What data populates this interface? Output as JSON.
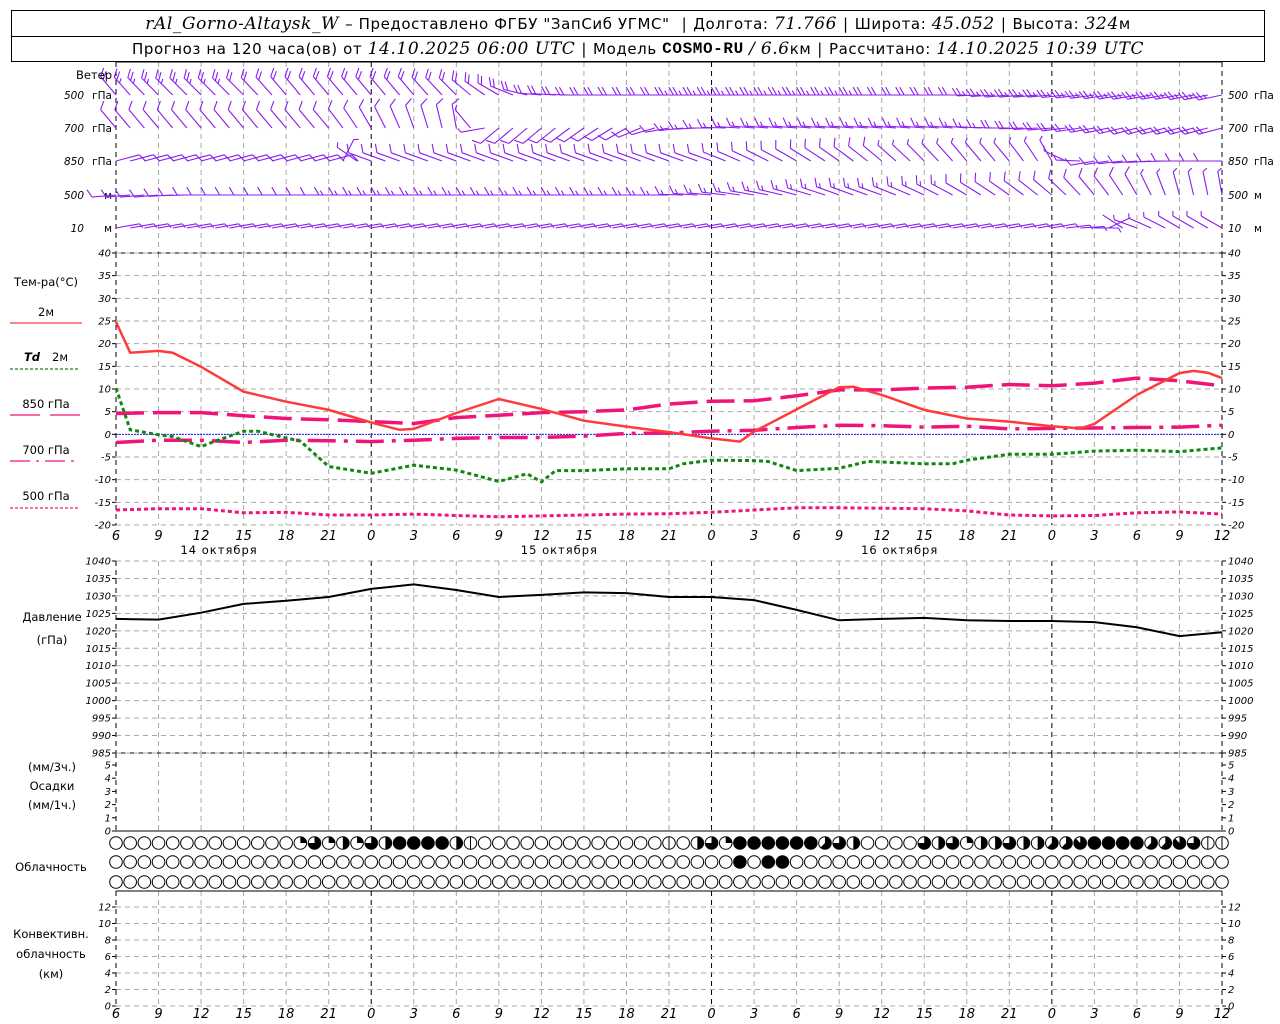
{
  "header": {
    "title": "rAl_Gorno-Altaysk_W",
    "provider": "– Предоставлено ФГБУ \"ЗапСиб УГМС\"",
    "separator": "|",
    "lon_label": "Долгота:",
    "lon": "71.766",
    "lat_label": "Широта:",
    "lat": "45.052",
    "alt_label": "Высота:",
    "alt": "324",
    "alt_unit": "м",
    "forecast_label": "Прогноз на 120 часа(ов) от",
    "forecast_start": "14.10.2025 06:00 UTC",
    "model_label": "Модель",
    "model": "COSMO-RU",
    "slash": "/",
    "resolution": "6.6",
    "resolution_unit": "км",
    "calc_label": "Рассчитано:",
    "calc_time": "14.10.2025 10:39 UTC"
  },
  "colors": {
    "wind": "#8a1cf0",
    "t2m": "#ff3a3a",
    "td2m": "#108810",
    "upper_air": "#f0147a",
    "zero_line": "#2020ff",
    "pressure": "#000000",
    "grid": "#a8a8a8"
  },
  "time_axis": {
    "x": [
      "14.10 06:00",
      "14.10 09:00",
      "14.10 12:00",
      "14.10 15:00",
      "14.10 18:00",
      "14.10 21:00",
      "15.10 00:00",
      "15.10 03:00",
      "15.10 06:00",
      "15.10 09:00",
      "15.10 12:00",
      "15.10 15:00",
      "15.10 18:00",
      "15.10 21:00",
      "16.10 00:00",
      "16.10 03:00",
      "16.10 06:00",
      "16.10 09:00",
      "16.10 12:00",
      "16.10 15:00",
      "16.10 18:00",
      "16.10 21:00",
      "17.10 00:00",
      "17.10 03:00",
      "17.10 06:00",
      "17.10 09:00",
      "17.10 12:00"
    ],
    "tick_labels": [
      "6",
      "9",
      "12",
      "15",
      "18",
      "21",
      "0",
      "3",
      "6",
      "9",
      "12",
      "15",
      "18",
      "21",
      "0",
      "3",
      "6",
      "9",
      "12",
      "15",
      "18",
      "21",
      "0",
      "3",
      "6",
      "9",
      "12"
    ],
    "date_labels": [
      "14 октября",
      "15 октября",
      "16 октября"
    ]
  },
  "chart_data": [
    {
      "type": "wind-barbs",
      "title": "Ветер",
      "levels": [
        {
          "value": "500",
          "unit": "гПа",
          "dir": [
            320,
            315,
            315,
            315,
            320,
            320,
            320,
            320,
            315,
            300,
            275,
            270,
            270,
            270,
            270,
            270,
            270,
            270,
            270,
            270,
            270,
            265,
            265,
            262,
            260,
            260,
            258
          ],
          "speed": [
            22,
            25,
            25,
            22,
            20,
            20,
            20,
            20,
            20,
            20,
            20,
            22,
            22,
            22,
            25,
            25,
            25,
            25,
            22,
            22,
            22,
            25,
            25,
            25,
            25,
            25,
            25
          ]
        },
        {
          "value": "700",
          "unit": "гПа",
          "dir": [
            320,
            320,
            320,
            320,
            320,
            320,
            330,
            340,
            350,
            230,
            230,
            235,
            240,
            260,
            270,
            275,
            275,
            275,
            275,
            275,
            275,
            270,
            265,
            260,
            255,
            255,
            255
          ],
          "speed": [
            12,
            12,
            12,
            12,
            12,
            12,
            10,
            10,
            8,
            8,
            8,
            8,
            10,
            12,
            15,
            15,
            15,
            15,
            15,
            15,
            15,
            18,
            18,
            20,
            20,
            20,
            20
          ]
        },
        {
          "value": "850",
          "unit": "гПа",
          "dir": [
            75,
            75,
            75,
            75,
            75,
            75,
            290,
            290,
            290,
            290,
            290,
            290,
            290,
            290,
            290,
            295,
            300,
            305,
            310,
            315,
            320,
            320,
            330,
            260,
            265,
            270,
            270
          ],
          "speed": [
            8,
            8,
            8,
            8,
            8,
            8,
            12,
            12,
            12,
            12,
            12,
            12,
            12,
            12,
            12,
            12,
            10,
            10,
            8,
            6,
            6,
            6,
            5,
            10,
            12,
            12,
            12
          ]
        },
        {
          "value": "500",
          "unit": "м",
          "dir": [
            265,
            265,
            270,
            270,
            270,
            270,
            270,
            270,
            270,
            270,
            270,
            270,
            270,
            270,
            275,
            280,
            285,
            290,
            290,
            295,
            300,
            305,
            310,
            320,
            330,
            345,
            350
          ],
          "speed": [
            8,
            8,
            10,
            12,
            12,
            12,
            14,
            15,
            15,
            15,
            15,
            15,
            15,
            15,
            15,
            15,
            14,
            14,
            14,
            14,
            12,
            12,
            10,
            10,
            8,
            6,
            6
          ]
        },
        {
          "value": "10",
          "unit": "м",
          "dir": [
            80,
            80,
            80,
            80,
            80,
            80,
            80,
            80,
            80,
            80,
            80,
            80,
            80,
            80,
            80,
            80,
            80,
            80,
            80,
            80,
            80,
            80,
            80,
            90,
            290,
            300,
            300
          ],
          "speed": [
            4,
            5,
            5,
            5,
            5,
            5,
            5,
            5,
            6,
            6,
            6,
            5,
            5,
            5,
            5,
            5,
            5,
            5,
            5,
            5,
            5,
            5,
            5,
            5,
            6,
            7,
            7
          ]
        }
      ]
    },
    {
      "type": "line",
      "legend_title": "Тем-ра(°C)",
      "ylim": [
        -20,
        40
      ],
      "yticks": [
        40,
        35,
        30,
        25,
        20,
        15,
        10,
        5,
        0,
        -5,
        -10,
        -15,
        -20
      ],
      "grid": true,
      "legend_placement": "left",
      "series": [
        {
          "name": "2м",
          "style": "solid",
          "color": "#ff3a3a",
          "points": [
            [
              "14.10 06:00",
              24.8
            ],
            [
              "14.10 07:00",
              18.0
            ],
            [
              "14.10 09:00",
              18.4
            ],
            [
              "14.10 10:00",
              18.0
            ],
            [
              "14.10 12:00",
              14.9
            ],
            [
              "14.10 15:00",
              9.4
            ],
            [
              "14.10 18:00",
              7.2
            ],
            [
              "14.10 21:00",
              5.4
            ],
            [
              "15.10 00:00",
              2.6
            ],
            [
              "15.10 02:00",
              1.0
            ],
            [
              "15.10 03:00",
              1.2
            ],
            [
              "15.10 06:00",
              4.7
            ],
            [
              "15.10 09:00",
              7.8
            ],
            [
              "15.10 12:00",
              5.6
            ],
            [
              "15.10 15:00",
              3.0
            ],
            [
              "15.10 18:00",
              1.7
            ],
            [
              "15.10 21:00",
              0.5
            ],
            [
              "16.10 00:00",
              -0.9
            ],
            [
              "16.10 02:00",
              -1.6
            ],
            [
              "16.10 03:00",
              0.6
            ],
            [
              "16.10 06:00",
              5.5
            ],
            [
              "16.10 09:00",
              10.4
            ],
            [
              "16.10 10:00",
              10.5
            ],
            [
              "16.10 12:00",
              8.7
            ],
            [
              "16.10 15:00",
              5.4
            ],
            [
              "16.10 18:00",
              3.5
            ],
            [
              "16.10 21:00",
              2.8
            ],
            [
              "17.10 00:00",
              1.8
            ],
            [
              "17.10 02:00",
              1.3
            ],
            [
              "17.10 03:00",
              2.3
            ],
            [
              "17.10 06:00",
              8.7
            ],
            [
              "17.10 09:00",
              13.5
            ],
            [
              "17.10 10:00",
              14.0
            ],
            [
              "17.10 11:00",
              13.6
            ],
            [
              "17.10 12:00",
              12.4
            ]
          ]
        },
        {
          "name_prefix": "Td",
          "name": "2м",
          "style": "dotted",
          "color": "#108810",
          "points": [
            [
              "14.10 06:00",
              10.2
            ],
            [
              "14.10 07:00",
              1.0
            ],
            [
              "14.10 09:00",
              -0.1
            ],
            [
              "14.10 10:00",
              -0.5
            ],
            [
              "14.10 12:00",
              -2.7
            ],
            [
              "14.10 13:00",
              -1.5
            ],
            [
              "14.10 15:00",
              0.7
            ],
            [
              "14.10 16:00",
              0.7
            ],
            [
              "14.10 18:00",
              -0.8
            ],
            [
              "14.10 19:00",
              -1.5
            ],
            [
              "14.10 21:00",
              -7.1
            ],
            [
              "15.10 00:00",
              -8.6
            ],
            [
              "15.10 03:00",
              -6.8
            ],
            [
              "15.10 06:00",
              -7.9
            ],
            [
              "15.10 09:00",
              -10.4
            ],
            [
              "15.10 11:00",
              -8.7
            ],
            [
              "15.10 12:00",
              -10.5
            ],
            [
              "15.10 13:00",
              -8.0
            ],
            [
              "15.10 15:00",
              -8.0
            ],
            [
              "15.10 18:00",
              -7.6
            ],
            [
              "15.10 21:00",
              -7.6
            ],
            [
              "15.10 22:00",
              -6.5
            ],
            [
              "16.10 00:00",
              -5.7
            ],
            [
              "16.10 03:00",
              -5.8
            ],
            [
              "16.10 04:00",
              -6.0
            ],
            [
              "16.10 06:00",
              -8.0
            ],
            [
              "16.10 09:00",
              -7.5
            ],
            [
              "16.10 11:00",
              -6.0
            ],
            [
              "16.10 12:00",
              -6.1
            ],
            [
              "16.10 15:00",
              -6.5
            ],
            [
              "16.10 17:00",
              -6.5
            ],
            [
              "16.10 18:00",
              -5.7
            ],
            [
              "16.10 21:00",
              -4.4
            ],
            [
              "17.10 00:00",
              -4.4
            ],
            [
              "17.10 03:00",
              -3.7
            ],
            [
              "17.10 06:00",
              -3.5
            ],
            [
              "17.10 09:00",
              -3.8
            ],
            [
              "17.10 12:00",
              -3.0
            ]
          ]
        },
        {
          "name": "850 гПа",
          "style": "dashed",
          "color": "#f0147a",
          "values": [
            4.6,
            4.8,
            4.8,
            4.1,
            3.5,
            3.2,
            2.8,
            2.4,
            3.7,
            4.2,
            4.8,
            5.0,
            5.4,
            6.7,
            7.3,
            7.4,
            8.5,
            9.8,
            9.8,
            10.2,
            10.4,
            11.0,
            10.7,
            11.3,
            12.4,
            11.8,
            10.7
          ]
        },
        {
          "name": "700 гПа",
          "style": "dash-dot",
          "color": "#f0147a",
          "values": [
            -1.8,
            -1.3,
            -1.3,
            -1.8,
            -1.3,
            -1.4,
            -1.6,
            -1.3,
            -0.9,
            -0.7,
            -0.7,
            -0.4,
            0.2,
            0.3,
            0.7,
            0.9,
            1.5,
            2.0,
            1.9,
            1.6,
            1.8,
            1.2,
            1.3,
            1.4,
            1.5,
            1.6,
            2.0
          ]
        },
        {
          "name": "500 гПа",
          "style": "dotted",
          "color": "#f0147a",
          "values": [
            -16.7,
            -16.4,
            -16.4,
            -17.3,
            -17.2,
            -17.8,
            -17.8,
            -17.6,
            -17.9,
            -18.2,
            -18.0,
            -17.8,
            -17.6,
            -17.5,
            -17.2,
            -16.7,
            -16.2,
            -16.2,
            -16.3,
            -16.4,
            -16.9,
            -17.8,
            -18.0,
            -17.9,
            -17.3,
            -17.1,
            -17.6
          ]
        }
      ]
    },
    {
      "type": "line",
      "ylabel": [
        "Давление",
        "(гПа)"
      ],
      "ylim": [
        985,
        1040
      ],
      "yticks": [
        1040,
        1035,
        1030,
        1025,
        1020,
        1015,
        1010,
        1005,
        1000,
        995,
        990,
        985
      ],
      "grid": true,
      "values": [
        1023.4,
        1023.2,
        1025.2,
        1027.7,
        1028.6,
        1029.7,
        1032.0,
        1033.3,
        1031.7,
        1029.7,
        1030.3,
        1031.0,
        1030.8,
        1029.7,
        1029.7,
        1028.8,
        1026.0,
        1023.0,
        1023.4,
        1023.7,
        1023.0,
        1022.8,
        1022.8,
        1022.5,
        1021.0,
        1018.5,
        1019.6
      ]
    },
    {
      "type": "bar",
      "ylabel": [
        "(мм/3ч.)",
        "Осадки",
        "(мм/1ч.)"
      ],
      "ylim": [
        0,
        5
      ],
      "yticks": [
        5,
        4,
        3,
        2,
        1,
        0
      ],
      "grid": false
    },
    {
      "type": "table",
      "ylabel": "Облачность",
      "unit": "octas",
      "rows": [
        [
          0,
          0,
          0,
          0,
          0,
          0,
          0,
          0,
          0,
          0,
          0,
          0,
          0,
          2,
          6,
          2,
          4,
          2,
          6,
          4,
          8,
          8,
          8,
          8,
          4,
          1,
          0,
          0,
          0,
          0,
          0,
          0,
          0,
          0,
          0,
          0,
          0,
          0,
          0,
          1,
          0,
          4,
          6,
          2,
          8,
          8,
          8,
          8,
          8,
          8,
          5,
          6,
          4,
          0,
          0,
          0,
          0,
          6,
          4,
          6,
          2,
          4,
          4,
          6,
          4,
          4,
          5,
          5,
          7,
          8,
          8,
          8,
          8,
          5,
          5,
          7,
          6,
          1,
          1
        ],
        [
          0,
          0,
          0,
          0,
          0,
          0,
          0,
          0,
          0,
          0,
          0,
          0,
          0,
          0,
          0,
          0,
          0,
          0,
          0,
          0,
          0,
          0,
          0,
          0,
          0,
          0,
          0,
          0,
          0,
          0,
          0,
          0,
          0,
          0,
          0,
          0,
          0,
          0,
          0,
          0,
          0,
          0,
          0,
          0,
          8,
          0,
          8,
          8,
          0,
          0,
          0,
          0,
          0,
          0,
          0,
          0,
          0,
          0,
          0,
          0,
          0,
          0,
          0,
          0,
          0,
          0,
          0,
          0,
          0,
          0,
          0,
          0,
          0,
          0,
          0,
          0,
          0,
          0,
          0
        ],
        [
          0,
          0,
          0,
          0,
          0,
          0,
          0,
          0,
          0,
          0,
          0,
          0,
          0,
          0,
          0,
          0,
          0,
          0,
          0,
          0,
          0,
          0,
          0,
          0,
          0,
          0,
          0,
          0,
          0,
          0,
          0,
          0,
          0,
          0,
          0,
          0,
          0,
          0,
          0,
          0,
          0,
          0,
          0,
          0,
          0,
          0,
          0,
          0,
          0,
          0,
          0,
          0,
          0,
          0,
          0,
          0,
          0,
          0,
          0,
          0,
          0,
          0,
          0,
          0,
          0,
          0,
          0,
          0,
          0,
          0,
          0,
          0,
          0,
          0,
          0,
          0,
          0,
          0,
          0
        ]
      ]
    },
    {
      "type": "bar",
      "ylabel": [
        "Конвективн.",
        "облачность",
        "(км)"
      ],
      "ylim": [
        0,
        13
      ],
      "yticks": [
        12,
        10,
        8,
        6,
        4,
        2,
        0
      ],
      "grid": true
    }
  ]
}
